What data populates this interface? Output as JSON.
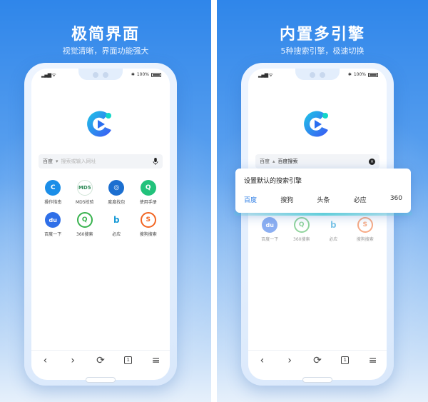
{
  "colors": {
    "accent": "#2a7be4",
    "panel_top": "#2f86ea",
    "logo_a": "#1ec6e6",
    "logo_b": "#3b57f5"
  },
  "left": {
    "headline": "极简界面",
    "subline": "视觉清晰，界面功能强大",
    "status": {
      "battery": "100%"
    },
    "search": {
      "engine": "百度",
      "placeholder": "搜索或输入网址",
      "mic_icon": "microphone-icon"
    },
    "apps": [
      {
        "label": "操作指南",
        "icon": "guide-app-icon",
        "color": "#1b8ee8"
      },
      {
        "label": "MD5校验",
        "icon": "md5-app-icon",
        "color": "#2e8b57"
      },
      {
        "label": "度度找包",
        "icon": "search-pack-app-icon",
        "color": "#1c6fd0"
      },
      {
        "label": "使用手册",
        "icon": "manual-app-icon",
        "color": "#22c27b"
      },
      {
        "label": "百度一下",
        "icon": "baidu-app-icon",
        "color": "#2f6fe8"
      },
      {
        "label": "360搜索",
        "icon": "360-app-icon",
        "color": "#37b24d"
      },
      {
        "label": "必应",
        "icon": "bing-app-icon",
        "color": "#1a9bd7"
      },
      {
        "label": "搜狗搜索",
        "icon": "sogou-app-icon",
        "color": "#f26522"
      }
    ],
    "toolbar": {
      "tabs_count": "1"
    }
  },
  "right": {
    "headline": "内置多引擎",
    "subline": "5种搜索引擎，极速切换",
    "status": {
      "battery": "100%"
    },
    "search": {
      "engine": "百度",
      "value": "百度搜索"
    },
    "popup": {
      "title": "设置默认的搜索引擎",
      "engines": [
        "百度",
        "搜狗",
        "头条",
        "必应",
        "360"
      ],
      "selected_index": 0
    },
    "apps": [
      {
        "label": "百度一下",
        "icon": "baidu-app-icon",
        "color": "#2f6fe8"
      },
      {
        "label": "360搜索",
        "icon": "360-app-icon",
        "color": "#37b24d"
      },
      {
        "label": "必应",
        "icon": "bing-app-icon",
        "color": "#1a9bd7"
      },
      {
        "label": "搜狗搜索",
        "icon": "sogou-app-icon",
        "color": "#f26522"
      }
    ],
    "toolbar": {
      "tabs_count": "1"
    }
  }
}
